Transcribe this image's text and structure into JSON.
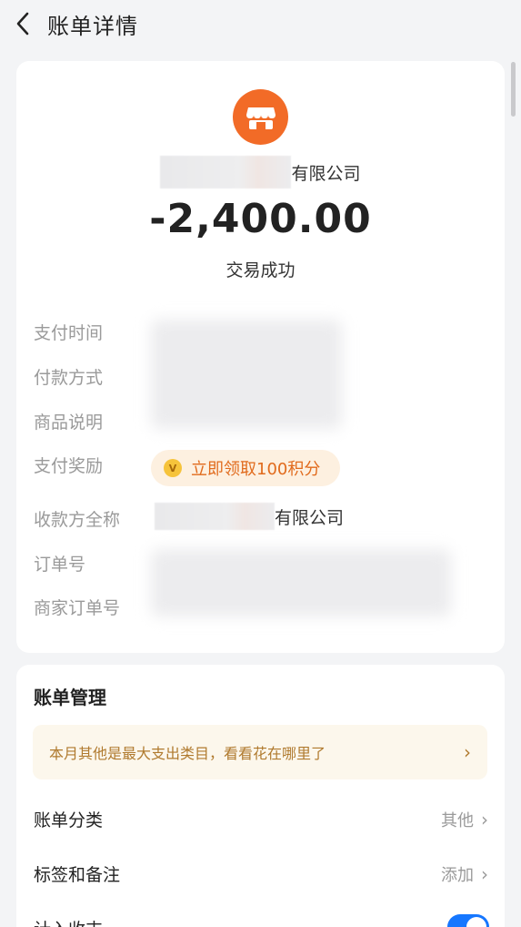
{
  "header": {
    "back_icon": "chevron-left-icon",
    "title": "账单详情"
  },
  "transaction": {
    "merchant_icon": "store-icon",
    "merchant_name_suffix": "有限公司",
    "amount": "-2,400.00",
    "status": "交易成功"
  },
  "details": {
    "pay_time_label": "支付时间",
    "pay_method_label": "付款方式",
    "product_desc_label": "商品说明",
    "reward_label": "支付奖励",
    "reward_chip_text": "立即领取100积分",
    "reward_coin_icon": "v-coin-icon",
    "payee_label": "收款方全称",
    "payee_suffix": "有限公司",
    "order_no_label": "订单号",
    "merchant_order_label": "商家订单号"
  },
  "manage": {
    "title": "账单管理",
    "tip_text": "本月其他是最大支出类目，看看花在哪里了",
    "category_label": "账单分类",
    "category_value": "其他",
    "tags_label": "标签和备注",
    "tags_value": "添加",
    "income_expense_label": "计入收支",
    "income_expense_enabled": true
  },
  "colors": {
    "accent_orange": "#f26b27",
    "reward_text": "#e16b1d",
    "toggle_blue": "#1677ff",
    "tip_text": "#b07a2e"
  }
}
